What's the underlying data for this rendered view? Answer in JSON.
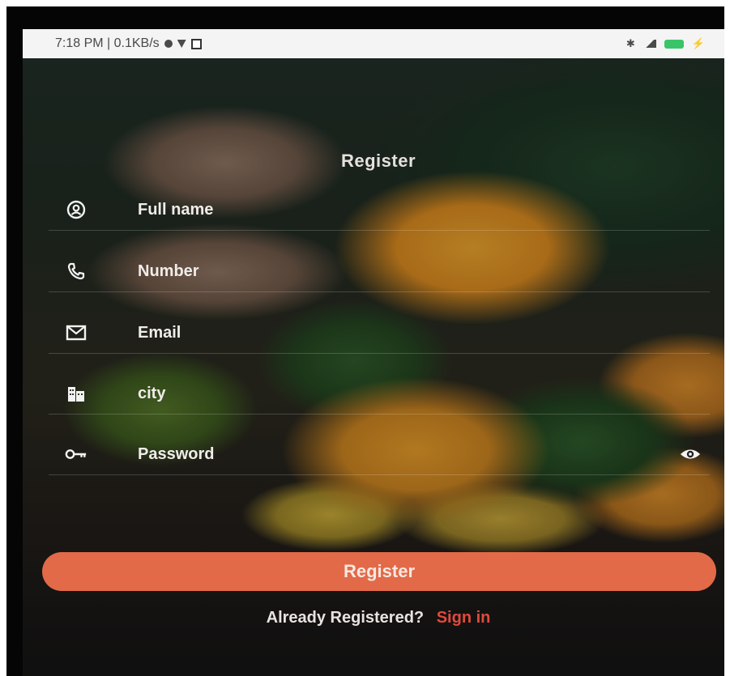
{
  "status_bar": {
    "time_net": "7:18 PM | 0.1KB/s",
    "right_icons": [
      "bluetooth-icon",
      "signal-icon",
      "battery-icon",
      "charging-icon"
    ],
    "left_icons": [
      "notification-icon",
      "wifi-icon",
      "screen-record-icon"
    ]
  },
  "screen": {
    "title": "Register",
    "fields": [
      {
        "placeholder": "Full name",
        "icon": "person-icon"
      },
      {
        "placeholder": "Number",
        "icon": "phone-icon"
      },
      {
        "placeholder": "Email",
        "icon": "email-icon"
      },
      {
        "placeholder": "city",
        "icon": "city-icon"
      },
      {
        "placeholder": "Password",
        "icon": "key-icon",
        "toggle_icon": "eye-icon"
      }
    ],
    "register_button": "Register",
    "already_registered": "Already Registered?",
    "sign_in": "Sign in"
  },
  "colors": {
    "accent": "#e26a48",
    "link": "#e04a3c",
    "battery": "#3ac468"
  }
}
